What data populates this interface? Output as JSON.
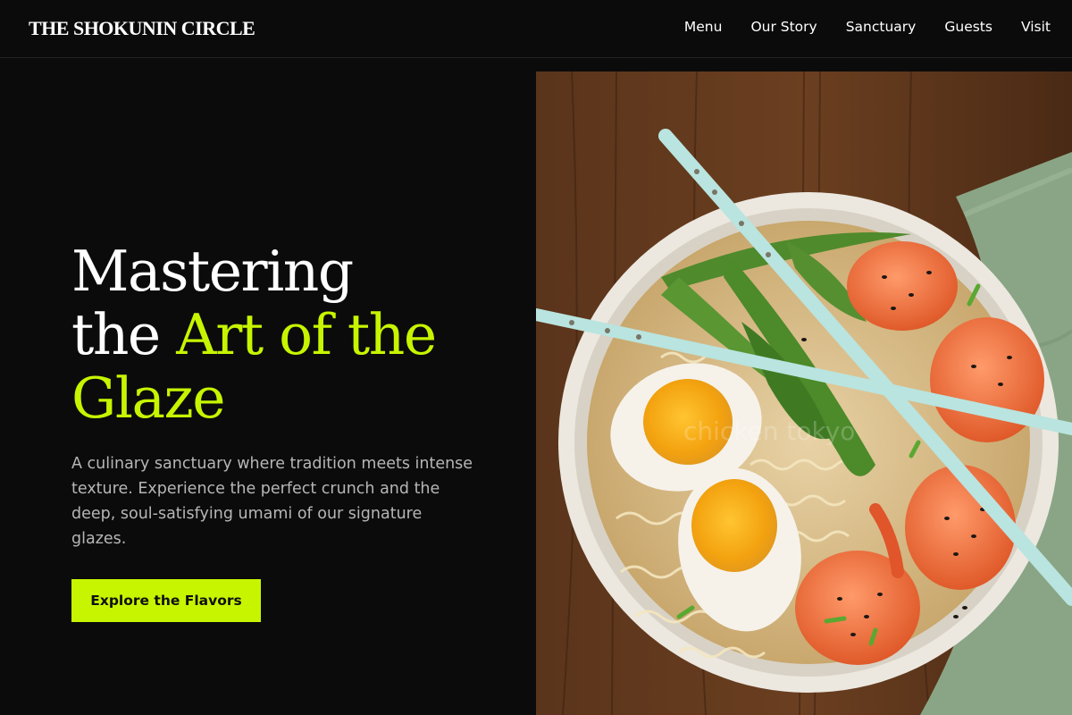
{
  "header": {
    "brand": "THE SHOKUNIN CIRCLE",
    "nav": [
      "Menu",
      "Our Story",
      "Sanctuary",
      "Guests",
      "Visit"
    ]
  },
  "hero": {
    "headline_line1": "Mastering",
    "headline_line2_plain": "the ",
    "headline_line2_accent": "Art of the",
    "headline_line3_accent": "Glaze",
    "description": "A culinary sanctuary where tradition meets intense texture. Experience the perfect crunch and the deep, soul-satisfying umami of our signature glazes.",
    "cta_label": "Explore the Flavors"
  },
  "photo": {
    "watermark": "chicken tokyo",
    "description_icon": "ramen-bowl-photo"
  },
  "colors": {
    "background": "#0b0b0b",
    "accent": "#c7f500",
    "body_text": "#b6b6b6"
  }
}
